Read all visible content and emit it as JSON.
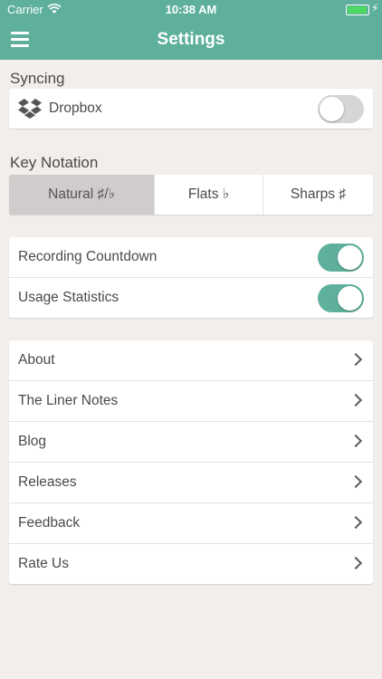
{
  "status_bar": {
    "carrier": "Carrier",
    "time": "10:38 AM"
  },
  "nav": {
    "title": "Settings"
  },
  "syncing": {
    "section_label": "Syncing",
    "dropbox_label": "Dropbox",
    "dropbox_enabled": false
  },
  "key_notation": {
    "section_label": "Key Notation",
    "options": [
      "Natural ♯/♭",
      "Flats ♭",
      "Sharps ♯"
    ],
    "selected": "Natural ♯/♭"
  },
  "toggles": [
    {
      "label": "Recording Countdown",
      "enabled": true
    },
    {
      "label": "Usage Statistics",
      "enabled": true
    }
  ],
  "links": [
    {
      "label": "About"
    },
    {
      "label": "The Liner Notes"
    },
    {
      "label": "Blog"
    },
    {
      "label": "Releases"
    },
    {
      "label": "Feedback"
    },
    {
      "label": "Rate Us"
    }
  ],
  "colors": {
    "accent": "#5eaf9c",
    "background": "#f1eeec",
    "segment_selected": "#cfcccb"
  }
}
